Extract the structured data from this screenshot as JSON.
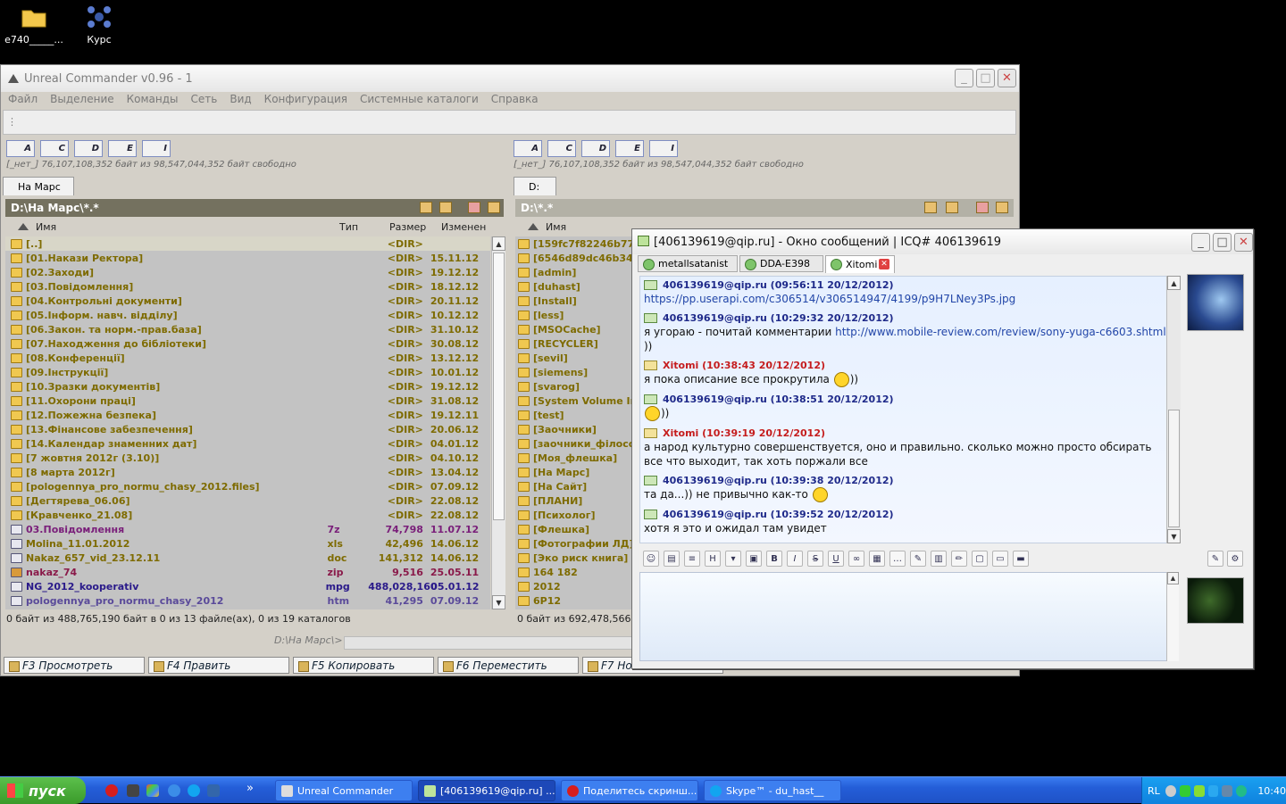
{
  "desktop": {
    "icons": [
      {
        "label": "e740_____...",
        "icon": "folder-icon"
      },
      {
        "label": "Курс",
        "icon": "molecule-icon"
      }
    ]
  },
  "uc": {
    "title": "Unreal Commander v0.96 - 1",
    "menu": [
      "Файл",
      "Выделение",
      "Команды",
      "Сеть",
      "Вид",
      "Конфигурация",
      "Системные каталоги",
      "Справка"
    ],
    "drives": [
      "A",
      "C",
      "D",
      "E",
      "I"
    ],
    "free_info": "[_нет_]  76,107,108,352 байт из  98,547,044,352 байт свободно",
    "left": {
      "tab": "На Марс",
      "path": "D:\\На Марс\\*.*",
      "columns": {
        "name": "Имя",
        "type": "Тип",
        "size": "Размер",
        "date": "Изменен"
      },
      "rows": [
        {
          "name": "[..]",
          "type": "",
          "size": "<DIR>",
          "date": "",
          "kind": "up"
        },
        {
          "name": "[01.Накази Ректора]",
          "type": "",
          "size": "<DIR>",
          "date": "15.11.12",
          "kind": "dir"
        },
        {
          "name": "[02.Заходи]",
          "type": "",
          "size": "<DIR>",
          "date": "19.12.12",
          "kind": "dir"
        },
        {
          "name": "[03.Повідомлення]",
          "type": "",
          "size": "<DIR>",
          "date": "18.12.12",
          "kind": "dir"
        },
        {
          "name": "[04.Контрольні документи]",
          "type": "",
          "size": "<DIR>",
          "date": "20.11.12",
          "kind": "dir"
        },
        {
          "name": "[05.Інформ. навч. відділу]",
          "type": "",
          "size": "<DIR>",
          "date": "10.12.12",
          "kind": "dir"
        },
        {
          "name": "[06.Закон. та норм.-прав.база]",
          "type": "",
          "size": "<DIR>",
          "date": "31.10.12",
          "kind": "dir"
        },
        {
          "name": "[07.Находження до бібліотеки]",
          "type": "",
          "size": "<DIR>",
          "date": "30.08.12",
          "kind": "dir"
        },
        {
          "name": "[08.Конференції]",
          "type": "",
          "size": "<DIR>",
          "date": "13.12.12",
          "kind": "dir"
        },
        {
          "name": "[09.Інструкції]",
          "type": "",
          "size": "<DIR>",
          "date": "10.01.12",
          "kind": "dir"
        },
        {
          "name": "[10.Зразки документів]",
          "type": "",
          "size": "<DIR>",
          "date": "19.12.12",
          "kind": "dir"
        },
        {
          "name": "[11.Охорони праці]",
          "type": "",
          "size": "<DIR>",
          "date": "31.08.12",
          "kind": "dir"
        },
        {
          "name": "[12.Пожежна безпека]",
          "type": "",
          "size": "<DIR>",
          "date": "19.12.11",
          "kind": "dir"
        },
        {
          "name": "[13.Фінансове забезпечення]",
          "type": "",
          "size": "<DIR>",
          "date": "20.06.12",
          "kind": "dir"
        },
        {
          "name": "[14.Календар знаменних дат]",
          "type": "",
          "size": "<DIR>",
          "date": "04.01.12",
          "kind": "dir"
        },
        {
          "name": "[7 жовтня 2012г (3.10)]",
          "type": "",
          "size": "<DIR>",
          "date": "04.10.12",
          "kind": "dir"
        },
        {
          "name": "[8 марта 2012г]",
          "type": "",
          "size": "<DIR>",
          "date": "13.04.12",
          "kind": "dir"
        },
        {
          "name": "[pologennya_pro_normu_chasy_2012.files]",
          "type": "",
          "size": "<DIR>",
          "date": "07.09.12",
          "kind": "dir"
        },
        {
          "name": "[Дегтярева_06.06]",
          "type": "",
          "size": "<DIR>",
          "date": "22.08.12",
          "kind": "dir"
        },
        {
          "name": "[Кравченко_21.08]",
          "type": "",
          "size": "<DIR>",
          "date": "22.08.12",
          "kind": "dir"
        },
        {
          "name": "03.Повідомлення",
          "type": "7z",
          "size": "74,798",
          "date": "11.07.12",
          "kind": "7z"
        },
        {
          "name": "Molina_11.01.2012",
          "type": "xls",
          "size": "42,496",
          "date": "14.06.12",
          "kind": "xls"
        },
        {
          "name": "Nakaz_657_vid_23.12.11",
          "type": "doc",
          "size": "141,312",
          "date": "14.06.12",
          "kind": "doc"
        },
        {
          "name": "nakaz_74",
          "type": "zip",
          "size": "9,516",
          "date": "25.05.11",
          "kind": "zip"
        },
        {
          "name": "NG_2012_kooperativ",
          "type": "mpg",
          "size": "488,028,160",
          "date": "05.01.12",
          "kind": "mpg"
        },
        {
          "name": "pologennya_pro_normu_chasy_2012",
          "type": "htm",
          "size": "41,295",
          "date": "07.09.12",
          "kind": "htm"
        }
      ],
      "status": "0 байт из 488,765,190 байт в 0 из 13 файле(ах), 0 из 19 каталогов"
    },
    "right": {
      "tab": "D:",
      "path": "D:\\*.*",
      "columns": {
        "name": "Имя"
      },
      "rows": [
        "[159fc7f82246b77cl",
        "[6546d89dc46b348",
        "[admin]",
        "[duhast]",
        "[Install]",
        "[less]",
        "[MSOCache]",
        "[RECYCLER]",
        "[sevil]",
        "[siemens]",
        "[svarog]",
        "[System Volume Inf",
        "[test]",
        "[Заочники]",
        "[заочники_філосов",
        "[Моя_флешка]",
        "[На Марс]",
        "[На Сайт]",
        "[ПЛАНИ]",
        "[Психолог]",
        "[Флешка]",
        "[Фотографии ЛД]",
        "[Эко риск книга]",
        "164 182",
        "2012",
        "6P12"
      ],
      "status": "0 байт из 692,478,566 ба"
    },
    "cmd_path": "D:\\На Марс\\>",
    "fkeys": [
      "F3 Просмотреть",
      "F4 Править",
      "F5 Копировать",
      "F6 Переместить",
      "F7 Но"
    ]
  },
  "qip": {
    "title": "[406139619@qip.ru] - Окно сообщений | ICQ# 406139619",
    "tabs": [
      "metallsatanist",
      "DDA-E398",
      "Xitomi"
    ],
    "messages": [
      {
        "who": "me",
        "header": "406139619@qip.ru (09:56:11 20/12/2012)",
        "text": "",
        "link": "https://pp.userapi.com/c306514/v306514947/4199/p9H7LNey3Ps.jpg",
        "after": "",
        "smile": false
      },
      {
        "who": "me",
        "header": "406139619@qip.ru (10:29:32 20/12/2012)",
        "text": "я угораю - почитай комментарии ",
        "link": "http://www.mobile-review.com/review/sony-yuga-c6603.shtml",
        "after": " ))",
        "smile": false
      },
      {
        "who": "them",
        "header": "Xitomi (10:38:43 20/12/2012)",
        "text": "я пока описание все прокрутила ",
        "link": "",
        "after": "))",
        "smile": true
      },
      {
        "who": "me",
        "header": "406139619@qip.ru (10:38:51 20/12/2012)",
        "text": "",
        "link": "",
        "after": "))",
        "smile": true
      },
      {
        "who": "them",
        "header": "Xitomi (10:39:19 20/12/2012)",
        "text": "а народ культурно совершенствуется, оно и правильно. сколько можно просто обсирать все что выходит, так хоть поржали все",
        "link": "",
        "after": "",
        "smile": false
      },
      {
        "who": "me",
        "header": "406139619@qip.ru (10:39:38 20/12/2012)",
        "text": "та да...)) не привычно как-то ",
        "link": "",
        "after": "",
        "smile": true
      },
      {
        "who": "me",
        "header": "406139619@qip.ru (10:39:52 20/12/2012)",
        "text": "хотя я это и ожидал там увидет",
        "link": "",
        "after": "",
        "smile": false
      }
    ]
  },
  "taskbar": {
    "start": "пуск",
    "buttons": [
      "Unreal Commander",
      "[406139619@qip.ru] ...",
      "Поделитесь скринш...",
      "Skype™ - du_hast__"
    ],
    "lang": "RL",
    "clock": "10:40"
  },
  "colors": {
    "dir": "#7e6b00",
    "pathbar": "#74715f",
    "me": "#1f2a8a",
    "them": "#c51d1d",
    "taskbar": "#245ed8"
  }
}
